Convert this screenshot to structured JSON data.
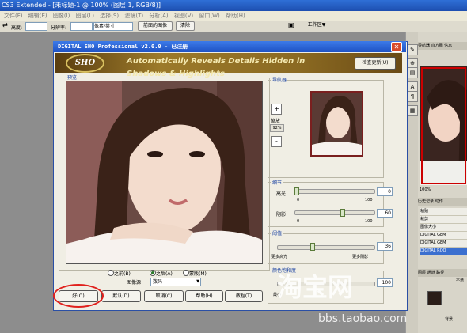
{
  "app": {
    "title": "CS3 Extended - [未标题-1 @ 100% (图层 1, RGB/8)]",
    "menu": [
      "文件(F)",
      "编辑(E)",
      "图像(I)",
      "图层(L)",
      "选择(S)",
      "滤镜(T)",
      "分析(A)",
      "视图(V)",
      "窗口(W)",
      "帮助(H)"
    ]
  },
  "options_bar": {
    "height_label": "高度:",
    "resolution_label": "分辨率:",
    "unit_value": "像素/英寸",
    "front_image_button": "前面的图像",
    "clear_button": "清除",
    "workspace_label": "工作区▼"
  },
  "dialog": {
    "title": "DIGITAL SHO Professional  v2.0.0 - 已注册",
    "logo_text": "SHO",
    "tagline": "Automatically Reveals Details Hidden in Shadows & Highlights",
    "check_update": "检查更新(U)",
    "preview_label": "预览",
    "zoom_label": "缩放",
    "zoom_plus": "+",
    "zoom_minus": "-",
    "zoom_value": "92%",
    "navigator_label": "导航器",
    "detail": {
      "group_label": "细节",
      "highlight_label": "高光",
      "highlight_value": "0",
      "highlight_level": 0.0,
      "highlight_min": "0",
      "highlight_max": "100",
      "shadow_label": "阴影",
      "shadow_value": "60",
      "shadow_level": 0.6,
      "shadow_min": "0",
      "shadow_max": "100"
    },
    "threshold": {
      "group_label": "阈值",
      "value": "36",
      "level": 0.36,
      "left_label": "更多高光",
      "right_label": "更多阴影"
    },
    "saturation": {
      "group_label": "颜色饱和度",
      "value": "100",
      "min_label": "最小"
    },
    "view_options": [
      "之前(B)",
      "之后(A)",
      "蒙版(M)"
    ],
    "view_selected": "之后(A)",
    "image_source_label": "图像源",
    "image_source_value": "数码",
    "buttons": {
      "ok": "好(O)",
      "default": "默认(D)",
      "cancel": "取消(C)",
      "help": "帮助(H)",
      "tutorial": "教程(T)"
    }
  },
  "panels": {
    "navigator_tabs": "导航器 直方图 信息",
    "zoom_value": "100%",
    "history_tabs": "历史记录 动作",
    "history_items": [
      "粘贴",
      "裁剪",
      "图像大小",
      "DIGITAL GEM",
      "DIGITAL GEM",
      "DIGITAL ROO"
    ],
    "history_selected_index": 5,
    "layers_tabs": "图层 通道 路径",
    "opacity_label": "不透",
    "layer_name": "背景"
  },
  "watermark": {
    "logo_text": "淘宝网",
    "url": "bbs.taobao.com"
  },
  "colors": {
    "title_blue": "#1f52c4",
    "banner_gold": "#9c7a2a",
    "highlight_circle": "#e0201c"
  }
}
